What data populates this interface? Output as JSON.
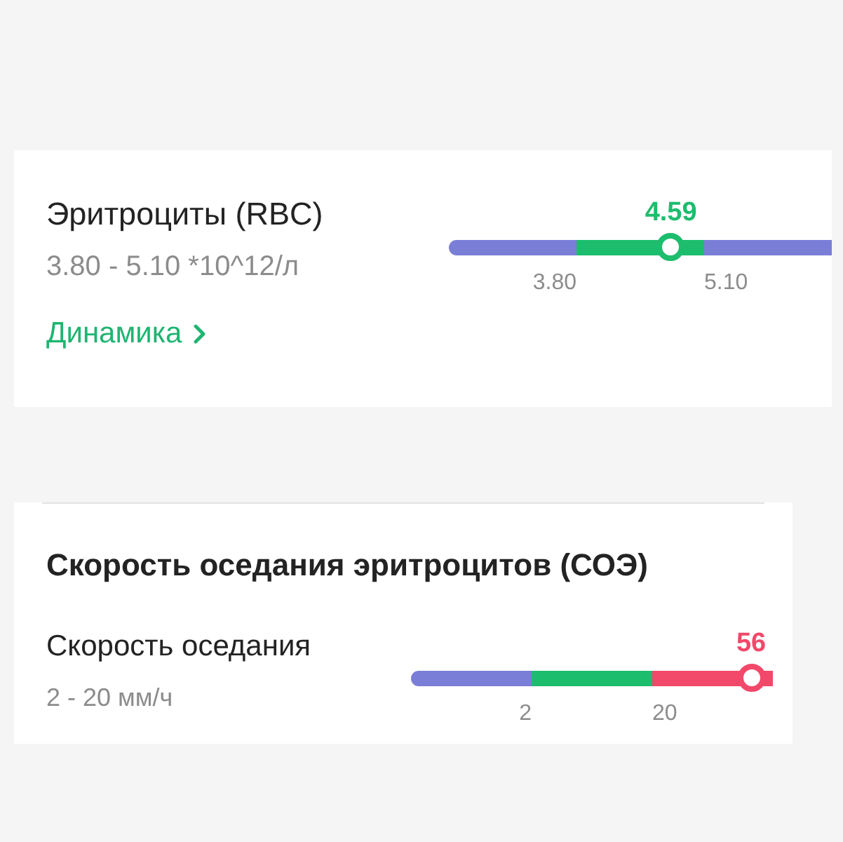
{
  "panels": [
    {
      "kind": "card",
      "title": "Эритроциты (RBC)",
      "range": "3.80 - 5.10 *10^12/л",
      "link": "Динамика",
      "meter": {
        "value": "4.59",
        "level": 0.58,
        "low": "3.80",
        "high": "5.10",
        "zones": [
          {
            "color": "#7a7ed6"
          },
          {
            "color": "#1dbd6e"
          },
          {
            "color": "#7a7ed6"
          }
        ]
      }
    },
    {
      "kind": "section",
      "heading": "Скорость оседания эритроцитов (СОЭ)",
      "title": "Скорость оседания",
      "range": "2 - 20 мм/ч",
      "meter": {
        "value": "56",
        "level": 0.94,
        "low": "2",
        "high": "20",
        "zones": [
          {
            "color": "#7a7ed6"
          },
          {
            "color": "#1dbd6e"
          },
          {
            "color": "#f2486a"
          }
        ]
      }
    }
  ]
}
